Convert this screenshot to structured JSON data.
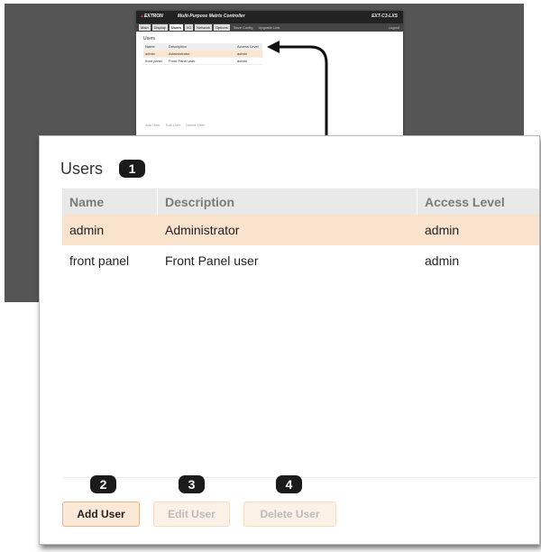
{
  "mini": {
    "logo": "EXTRON",
    "product": "Multi-Purpose Matrix Controller",
    "model": "EXT-C3-LXS",
    "tabs": [
      "Main",
      "Display",
      "Users",
      "I/O",
      "Network",
      "Options"
    ],
    "extra_tabs": [
      "Save Config",
      "Upgrade Link"
    ],
    "logout": "Logout",
    "title": "Users",
    "headers": [
      "Name",
      "Description",
      "Access Level"
    ],
    "rows": [
      [
        "admin",
        "Administrator",
        "admin"
      ],
      [
        "front panel",
        "Front Panel user",
        "admin"
      ]
    ],
    "buttons": [
      "Add User",
      "Edit User",
      "Delete User"
    ]
  },
  "panel": {
    "title": "Users",
    "badges": [
      "1",
      "2",
      "3",
      "4"
    ],
    "columns": {
      "name": "Name",
      "description": "Description",
      "access_level": "Access Level"
    },
    "rows": [
      {
        "name": "admin",
        "description": "Administrator",
        "access_level": "admin",
        "selected": true
      },
      {
        "name": "front panel",
        "description": "Front Panel user",
        "access_level": "admin",
        "selected": false
      }
    ],
    "buttons": {
      "add": "Add User",
      "edit": "Edit User",
      "delete": "Delete User"
    }
  },
  "colors": {
    "selected_row": "#fae3cd",
    "badge": "#1b1b1b",
    "background": "#555555"
  }
}
